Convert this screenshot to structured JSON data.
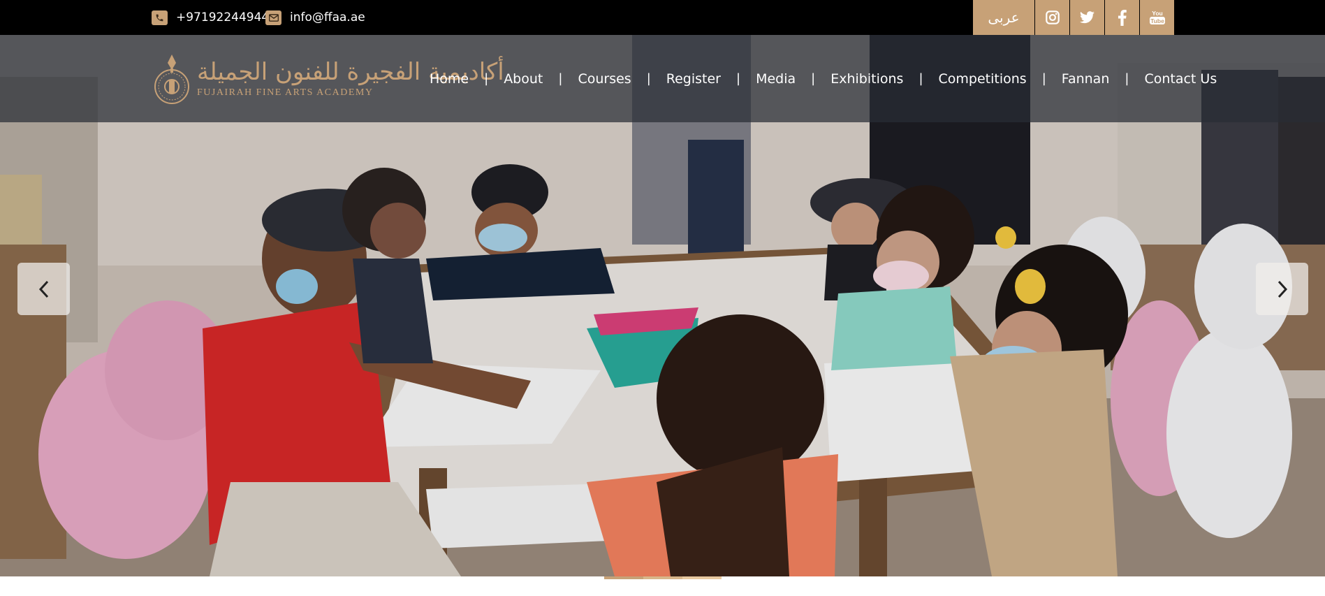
{
  "topbar": {
    "phone": "+97192244944",
    "email": "info@ffaa.ae",
    "language_label": "عربى",
    "social": [
      "instagram-icon",
      "twitter-icon",
      "facebook-icon",
      "youtube-icon"
    ]
  },
  "logo": {
    "arabic": "أكاديمية الفجيرة للفنون الجميلة",
    "english": "FUJAIRAH FINE ARTS ACADEMY"
  },
  "nav": {
    "items": [
      {
        "label": "Home"
      },
      {
        "label": "About"
      },
      {
        "label": "Courses"
      },
      {
        "label": "Register"
      },
      {
        "label": "Media"
      },
      {
        "label": "Exhibitions"
      },
      {
        "label": "Competitions"
      },
      {
        "label": "Fannan"
      },
      {
        "label": "Contact Us"
      }
    ],
    "separator": "|"
  },
  "carousel": {
    "prev_icon": "chevron-left-icon",
    "next_icon": "chevron-right-icon",
    "indicator_colors": [
      "#c7a177",
      "#d8b68a",
      "#e8c9a0"
    ]
  },
  "colors": {
    "accent": "#c7a177",
    "topbar": "#000000",
    "nav_overlay": "rgba(40,44,52,0.72)"
  }
}
